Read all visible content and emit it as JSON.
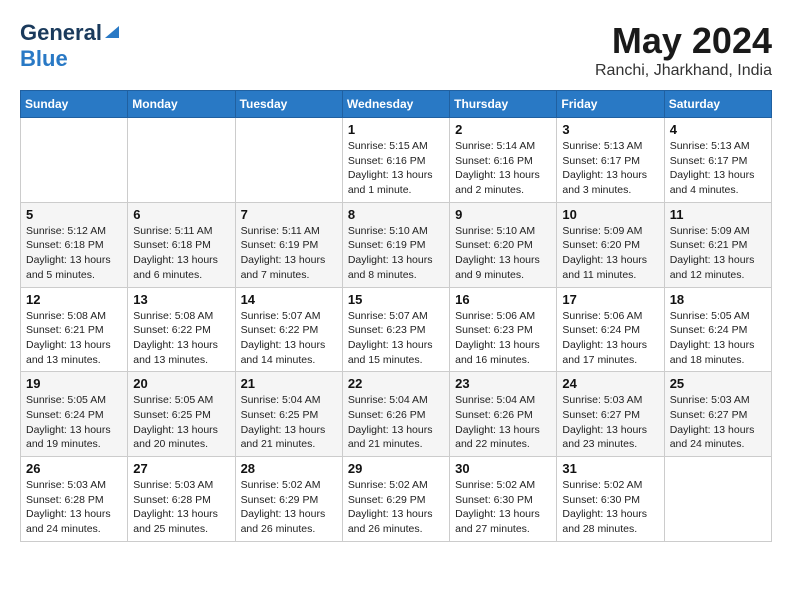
{
  "header": {
    "logo_general": "General",
    "logo_blue": "Blue",
    "title": "May 2024",
    "subtitle": "Ranchi, Jharkhand, India"
  },
  "calendar": {
    "days_of_week": [
      "Sunday",
      "Monday",
      "Tuesday",
      "Wednesday",
      "Thursday",
      "Friday",
      "Saturday"
    ],
    "weeks": [
      [
        {
          "day": "",
          "info": ""
        },
        {
          "day": "",
          "info": ""
        },
        {
          "day": "",
          "info": ""
        },
        {
          "day": "1",
          "info": "Sunrise: 5:15 AM\nSunset: 6:16 PM\nDaylight: 13 hours\nand 1 minute."
        },
        {
          "day": "2",
          "info": "Sunrise: 5:14 AM\nSunset: 6:16 PM\nDaylight: 13 hours\nand 2 minutes."
        },
        {
          "day": "3",
          "info": "Sunrise: 5:13 AM\nSunset: 6:17 PM\nDaylight: 13 hours\nand 3 minutes."
        },
        {
          "day": "4",
          "info": "Sunrise: 5:13 AM\nSunset: 6:17 PM\nDaylight: 13 hours\nand 4 minutes."
        }
      ],
      [
        {
          "day": "5",
          "info": "Sunrise: 5:12 AM\nSunset: 6:18 PM\nDaylight: 13 hours\nand 5 minutes."
        },
        {
          "day": "6",
          "info": "Sunrise: 5:11 AM\nSunset: 6:18 PM\nDaylight: 13 hours\nand 6 minutes."
        },
        {
          "day": "7",
          "info": "Sunrise: 5:11 AM\nSunset: 6:19 PM\nDaylight: 13 hours\nand 7 minutes."
        },
        {
          "day": "8",
          "info": "Sunrise: 5:10 AM\nSunset: 6:19 PM\nDaylight: 13 hours\nand 8 minutes."
        },
        {
          "day": "9",
          "info": "Sunrise: 5:10 AM\nSunset: 6:20 PM\nDaylight: 13 hours\nand 9 minutes."
        },
        {
          "day": "10",
          "info": "Sunrise: 5:09 AM\nSunset: 6:20 PM\nDaylight: 13 hours\nand 11 minutes."
        },
        {
          "day": "11",
          "info": "Sunrise: 5:09 AM\nSunset: 6:21 PM\nDaylight: 13 hours\nand 12 minutes."
        }
      ],
      [
        {
          "day": "12",
          "info": "Sunrise: 5:08 AM\nSunset: 6:21 PM\nDaylight: 13 hours\nand 13 minutes."
        },
        {
          "day": "13",
          "info": "Sunrise: 5:08 AM\nSunset: 6:22 PM\nDaylight: 13 hours\nand 13 minutes."
        },
        {
          "day": "14",
          "info": "Sunrise: 5:07 AM\nSunset: 6:22 PM\nDaylight: 13 hours\nand 14 minutes."
        },
        {
          "day": "15",
          "info": "Sunrise: 5:07 AM\nSunset: 6:23 PM\nDaylight: 13 hours\nand 15 minutes."
        },
        {
          "day": "16",
          "info": "Sunrise: 5:06 AM\nSunset: 6:23 PM\nDaylight: 13 hours\nand 16 minutes."
        },
        {
          "day": "17",
          "info": "Sunrise: 5:06 AM\nSunset: 6:24 PM\nDaylight: 13 hours\nand 17 minutes."
        },
        {
          "day": "18",
          "info": "Sunrise: 5:05 AM\nSunset: 6:24 PM\nDaylight: 13 hours\nand 18 minutes."
        }
      ],
      [
        {
          "day": "19",
          "info": "Sunrise: 5:05 AM\nSunset: 6:24 PM\nDaylight: 13 hours\nand 19 minutes."
        },
        {
          "day": "20",
          "info": "Sunrise: 5:05 AM\nSunset: 6:25 PM\nDaylight: 13 hours\nand 20 minutes."
        },
        {
          "day": "21",
          "info": "Sunrise: 5:04 AM\nSunset: 6:25 PM\nDaylight: 13 hours\nand 21 minutes."
        },
        {
          "day": "22",
          "info": "Sunrise: 5:04 AM\nSunset: 6:26 PM\nDaylight: 13 hours\nand 21 minutes."
        },
        {
          "day": "23",
          "info": "Sunrise: 5:04 AM\nSunset: 6:26 PM\nDaylight: 13 hours\nand 22 minutes."
        },
        {
          "day": "24",
          "info": "Sunrise: 5:03 AM\nSunset: 6:27 PM\nDaylight: 13 hours\nand 23 minutes."
        },
        {
          "day": "25",
          "info": "Sunrise: 5:03 AM\nSunset: 6:27 PM\nDaylight: 13 hours\nand 24 minutes."
        }
      ],
      [
        {
          "day": "26",
          "info": "Sunrise: 5:03 AM\nSunset: 6:28 PM\nDaylight: 13 hours\nand 24 minutes."
        },
        {
          "day": "27",
          "info": "Sunrise: 5:03 AM\nSunset: 6:28 PM\nDaylight: 13 hours\nand 25 minutes."
        },
        {
          "day": "28",
          "info": "Sunrise: 5:02 AM\nSunset: 6:29 PM\nDaylight: 13 hours\nand 26 minutes."
        },
        {
          "day": "29",
          "info": "Sunrise: 5:02 AM\nSunset: 6:29 PM\nDaylight: 13 hours\nand 26 minutes."
        },
        {
          "day": "30",
          "info": "Sunrise: 5:02 AM\nSunset: 6:30 PM\nDaylight: 13 hours\nand 27 minutes."
        },
        {
          "day": "31",
          "info": "Sunrise: 5:02 AM\nSunset: 6:30 PM\nDaylight: 13 hours\nand 28 minutes."
        },
        {
          "day": "",
          "info": ""
        }
      ]
    ]
  }
}
